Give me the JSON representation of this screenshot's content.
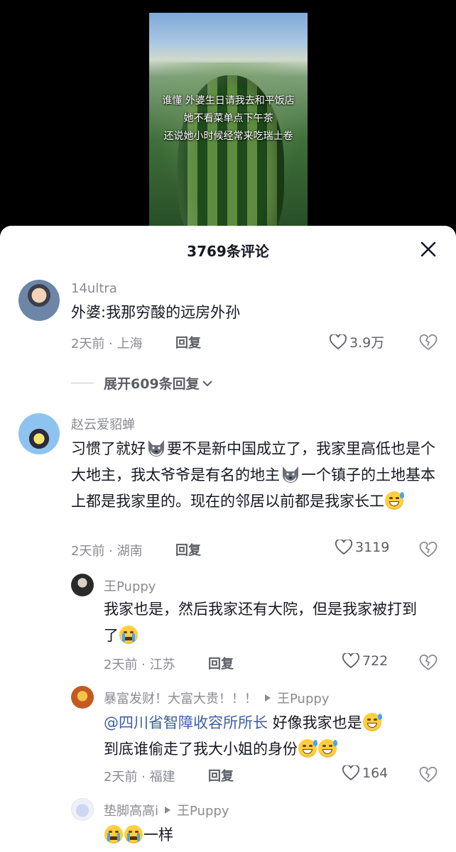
{
  "video": {
    "caption_lines": [
      "谁懂 外婆生日请我去和平饭店",
      "她不看菜单点下午茶",
      "还说她小时候经常来吃瑞士卷"
    ]
  },
  "sheet": {
    "title": "3769条评论"
  },
  "comments": [
    {
      "user": "14ultra",
      "text": "外婆:我那穷酸的远房外孙",
      "meta": "2天前 · 上海",
      "reply_label": "回复",
      "likes": "3.9万",
      "expand_label": "展开609条回复"
    },
    {
      "user": "赵云爱貂蝉",
      "text_parts": [
        "习惯了就好",
        "要不是新中国成立了，我家里高低也是个大地主，我太爷爷是有名的地主",
        "一个镇子的土地基本上都是我家里的。现在的邻居以前都是我家长工"
      ],
      "meta": "2天前 · 湖南",
      "reply_label": "回复",
      "likes": "3119",
      "replies": [
        {
          "user": "王Puppy",
          "text": "我家也是，然后我家还有大院，但是我家被打到了",
          "meta": "2天前 · 江苏",
          "reply_label": "回复",
          "likes": "722"
        },
        {
          "user": "暴富发财！大富大贵！！！",
          "reply_to": "王Puppy",
          "mention": "@四川省智障收容所所长",
          "text": "好像我家也是",
          "text2": "到底谁偷走了我大小姐的身份",
          "meta": "2天前 · 福建",
          "reply_label": "回复",
          "likes": "164"
        },
        {
          "user": "垫脚高高i",
          "reply_to": "王Puppy",
          "text": "一样"
        }
      ]
    }
  ],
  "icons": {
    "close": "close-icon",
    "heart": "heart-outline-icon",
    "dislike": "broken-heart-icon",
    "chevron": "chevron-down-icon",
    "reply_arrow": "triangle-right-icon"
  },
  "colors": {
    "text": "#161823",
    "muted": "#8a8b91",
    "mention": "#3f5ea8",
    "sheet_bg": "#ffffff"
  }
}
